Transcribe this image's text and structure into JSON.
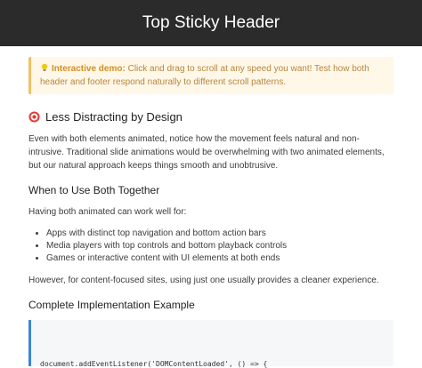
{
  "header": {
    "title": "Top Sticky Header"
  },
  "demo": {
    "lead": "Interactive demo:",
    "text": "Click and drag to scroll at any speed you want! Test how both header and footer respond naturally to different scroll patterns."
  },
  "section1": {
    "title": "Less Distracting by Design",
    "body": "Even with both elements animated, notice how the movement feels natural and non-intrusive. Traditional slide animations would be overwhelming with two animated elements, but our natural approach keeps things smooth and unobtrusive."
  },
  "section2": {
    "title": "When to Use Both Together",
    "intro": "Having both animated can work well for:",
    "items": [
      "Apps with distinct top navigation and bottom action bars",
      "Media players with top controls and bottom playback controls",
      "Games or interactive content with UI elements at both ends"
    ],
    "outro": "However, for content-focused sites, using just one usually provides a cleaner experience."
  },
  "section3": {
    "title": "Complete Implementation Example",
    "code": "document.addEventListener('DOMContentLoaded', () => {"
  },
  "colors": {
    "header_bg": "#2b2b2b",
    "demo_bg": "#fff8e9",
    "demo_border": "#f2c063",
    "code_border": "#3a86d8"
  },
  "icons": {
    "demo": "lightbulb-icon",
    "section1": "target-icon"
  }
}
